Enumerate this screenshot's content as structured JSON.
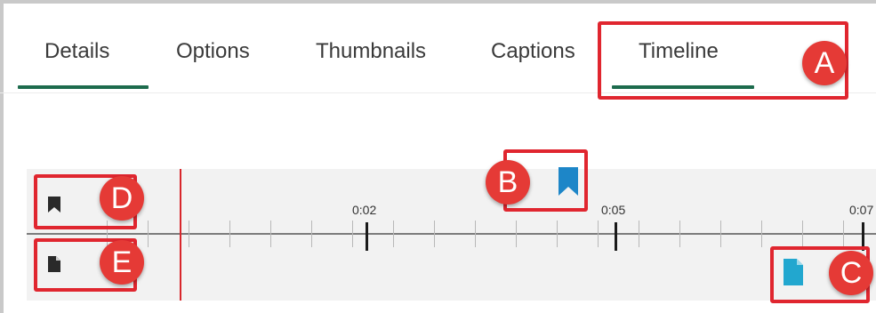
{
  "tabs": [
    {
      "label": "Details",
      "active": true
    },
    {
      "label": "Options",
      "active": false
    },
    {
      "label": "Thumbnails",
      "active": false
    },
    {
      "label": "Captions",
      "active": false
    },
    {
      "label": "Timeline",
      "active": true
    }
  ],
  "timeline": {
    "tick_labels": [
      "0:02",
      "0:05",
      "0:07"
    ]
  },
  "icons": {
    "bookmark_row": "bookmark-icon",
    "file_row": "file-icon",
    "bookmark_marker": "bookmark-marker-icon",
    "file_marker": "file-marker-icon"
  },
  "callouts": {
    "a": "A",
    "b": "B",
    "c": "C",
    "d": "D",
    "e": "E"
  },
  "colors": {
    "accent_green": "#1d6b4d",
    "playhead_red": "#d8262b",
    "callout_red": "#e53a36",
    "marker_blue": "#1d86c8",
    "file_marker_blue": "#22a7cf"
  }
}
